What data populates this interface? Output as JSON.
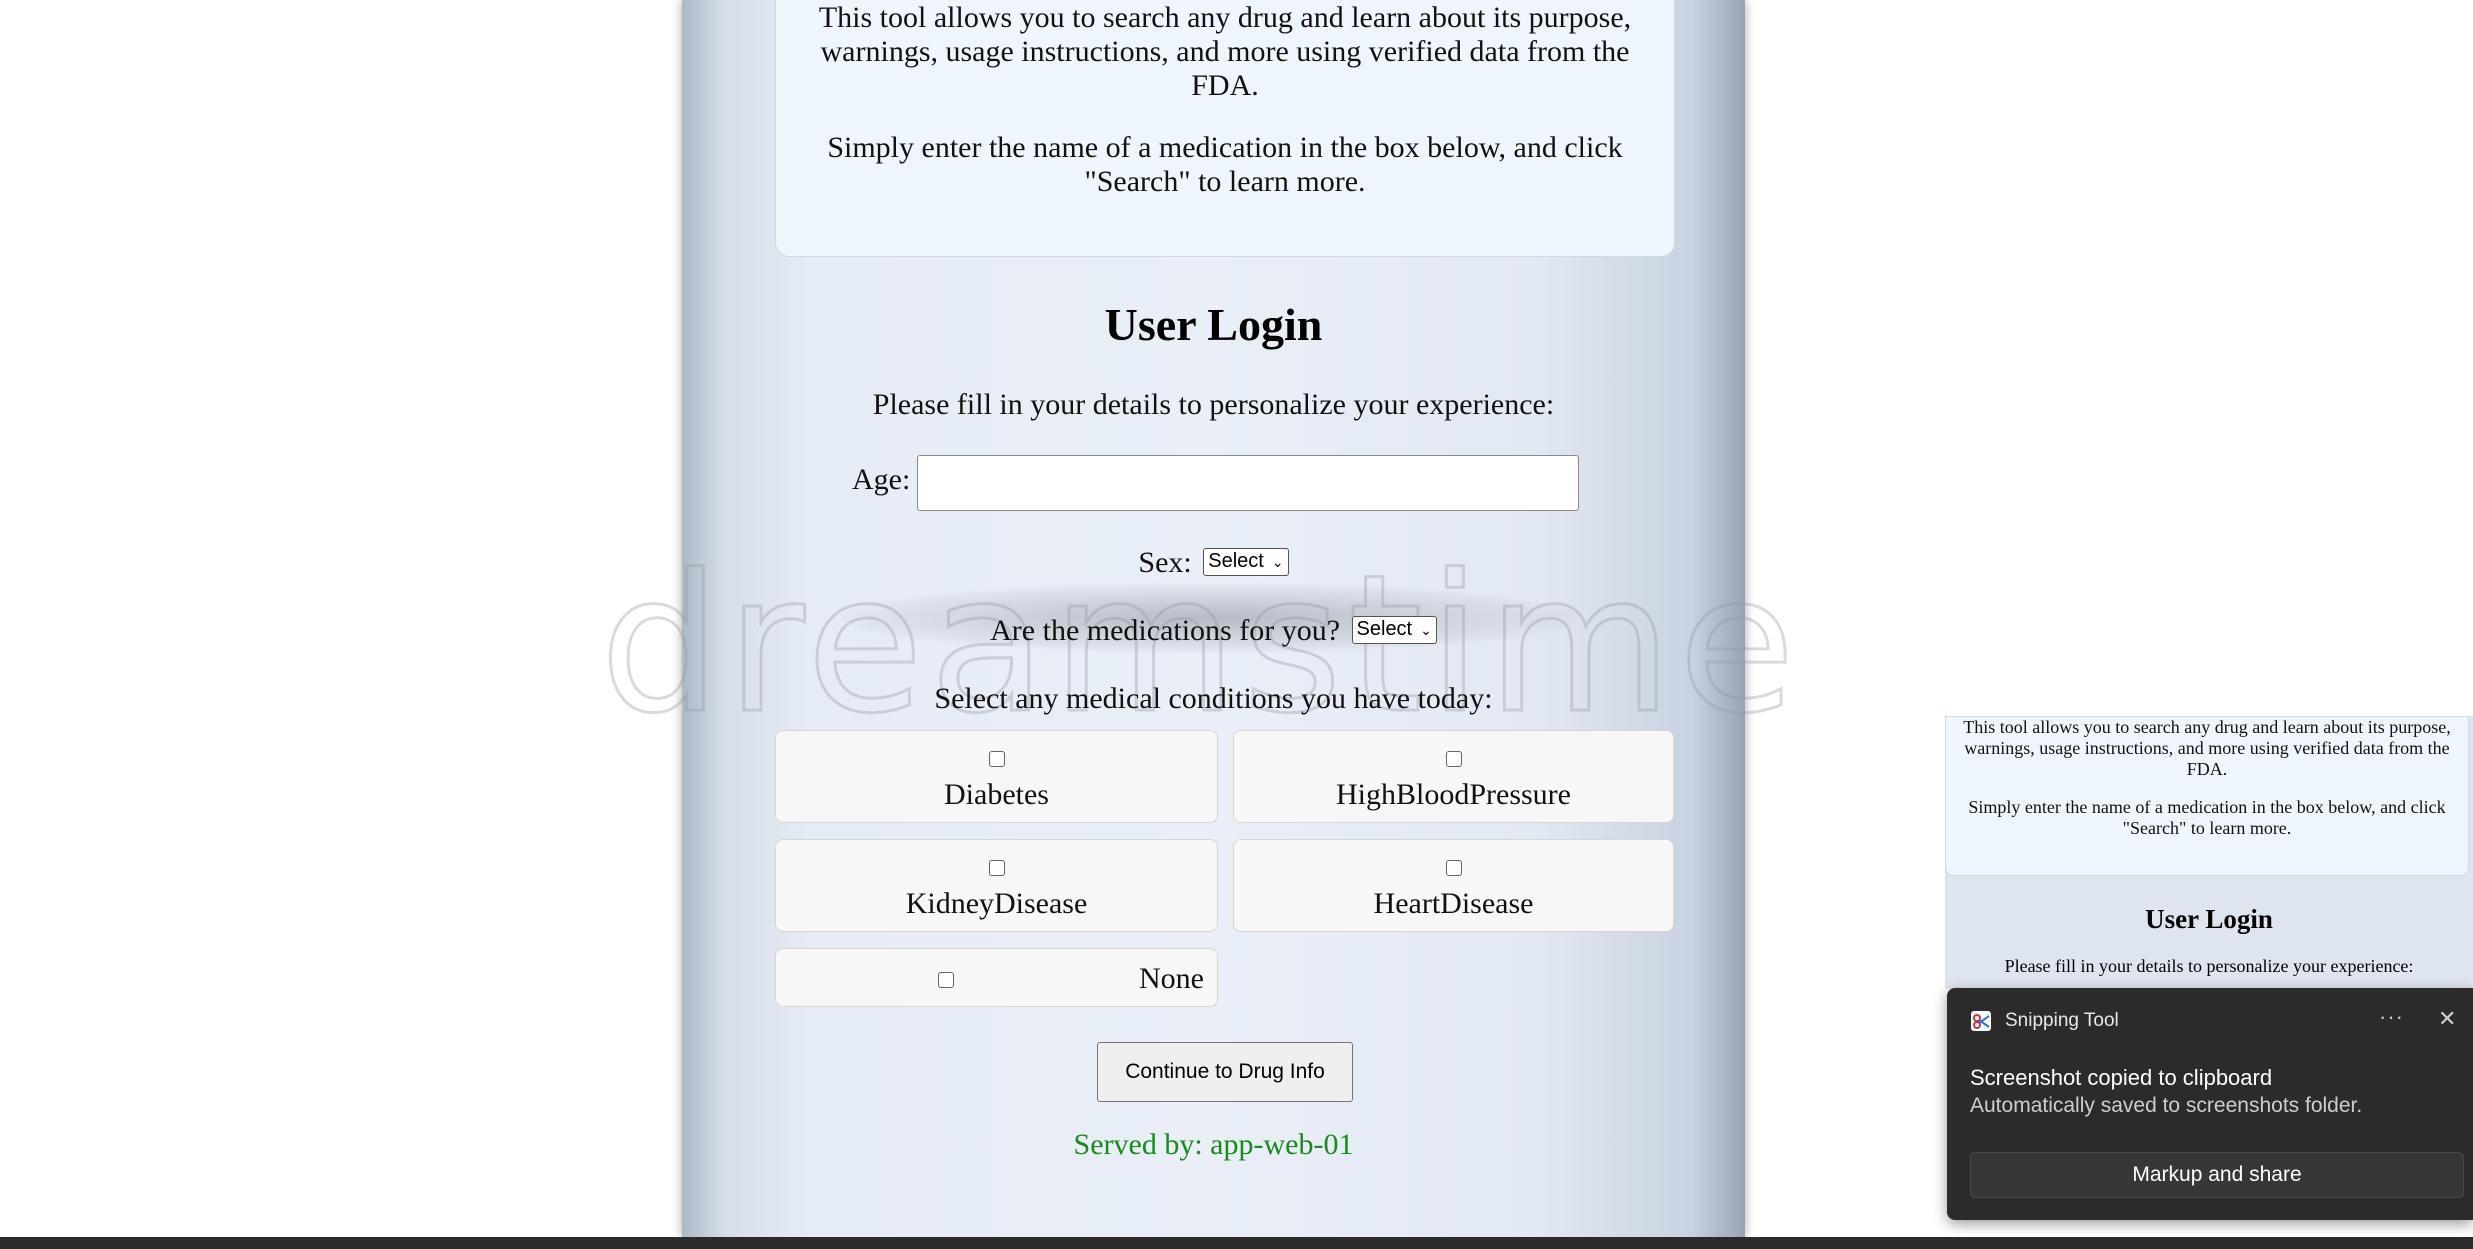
{
  "intro": {
    "paragraph1": "This tool allows you to search any drug and learn about its purpose, warnings, usage instructions, and more using verified data from the FDA.",
    "paragraph2": "Simply enter the name of a medication in the box below, and click \"Search\" to learn more."
  },
  "login": {
    "title": "User Login",
    "subtitle": "Please fill in your details to personalize your experience:",
    "age_label": "Age:",
    "age_value": "",
    "sex_label": "Sex:",
    "sex_selected": "Select",
    "med_for_you_label": "Are the medications for you?",
    "med_for_you_selected": "Select",
    "conditions_title": "Select any medical conditions you have today:",
    "conditions": [
      {
        "label": "Diabetes",
        "checked": false
      },
      {
        "label": "HighBloodPressure",
        "checked": false
      },
      {
        "label": "KidneyDisease",
        "checked": false
      },
      {
        "label": "HeartDisease",
        "checked": false
      },
      {
        "label": "None",
        "checked": false
      }
    ],
    "continue_label": "Continue to Drug Info",
    "served_by": "Served by: app-web-01"
  },
  "watermark": {
    "text": "dreamstime"
  },
  "preview": {
    "paragraph1": "This tool allows you to search any drug and learn about its purpose, warnings, usage instructions, and more using verified data from the FDA.",
    "paragraph2": "Simply enter the name of a medication in the box below, and click \"Search\" to learn more.",
    "title": "User Login",
    "subtitle": "Please fill in your details to personalize your experience:"
  },
  "toast": {
    "app_name": "Snipping Tool",
    "more_glyph": "···",
    "close_glyph": "✕",
    "heading": "Screenshot copied to clipboard",
    "body": "Automatically saved to screenshots folder.",
    "action_label": "Markup and share"
  },
  "colors": {
    "served_by": "#1a8a1a",
    "toast_bg": "#2b2b2b",
    "info_bg": "#eef5fd"
  }
}
